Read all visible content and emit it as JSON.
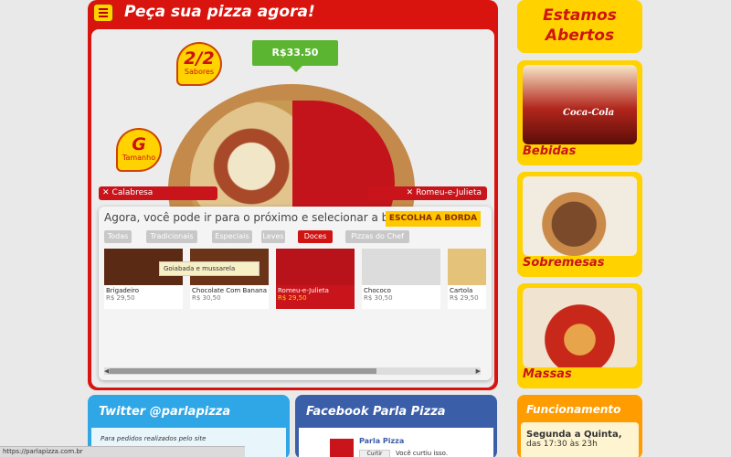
{
  "order": {
    "title": "Peça sua pizza agora!",
    "price": "R$33.50",
    "sabores_count": "2/2",
    "sabores_label": "Sabores",
    "size_letter": "G",
    "size_label": "Tamanho",
    "flavor_left": "Calabresa",
    "flavor_right": "Romeu-e-Julieta",
    "picker_message": "Agora, você pode ir para o próximo e selecionar a borda!",
    "edge_button": "ESCOLHA A BORDA",
    "tabs": [
      "Todas",
      "Tradicionais",
      "Especiais",
      "Leves",
      "Doces",
      "Pizzas do Chef"
    ],
    "active_tab": "Doces",
    "tooltip": "Goiabada e mussarela",
    "cards": [
      {
        "name": "Brigadeiro",
        "price": "R$ 29,50"
      },
      {
        "name": "Chocolate Com Banana",
        "price": "R$ 30,50"
      },
      {
        "name": "Romeu-e-Julieta",
        "price": "R$ 29,50"
      },
      {
        "name": "Chococo",
        "price": "R$ 30,50"
      },
      {
        "name": "Cartola",
        "price": "R$ 29,50"
      }
    ]
  },
  "sidebar": {
    "open_sign": "Estamos Abertos",
    "coke_brand": "Coca-Cola",
    "cards": [
      {
        "label": "Bebidas"
      },
      {
        "label": "Sobremesas"
      },
      {
        "label": "Massas"
      }
    ],
    "funcionamento": {
      "title": "Funcionamento",
      "day": "Segunda a Quinta,",
      "hours": "das 17:30 às 23h"
    }
  },
  "social": {
    "twitter_title": "Twitter @parlapizza",
    "twitter_text": "Para pedidos realizados pelo site",
    "facebook_title": "Facebook Parla Pizza",
    "fb_page": "Parla Pizza",
    "fb_like": "Curtir",
    "fb_text": "Você curtiu isso."
  },
  "status_url": "https://parlapizza.com.br"
}
